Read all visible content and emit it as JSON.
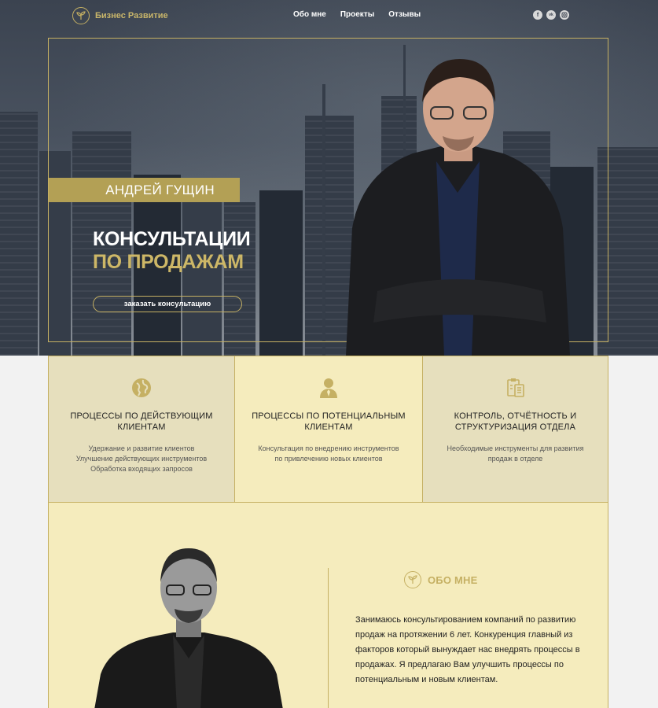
{
  "nav": {
    "logo_text": "Бизнес Развитие",
    "links": [
      "Обо мне",
      "Проекты",
      "Отзывы"
    ],
    "socials": [
      "f",
      "vk",
      "ig"
    ]
  },
  "hero": {
    "name": "АНДРЕЙ ГУЩИН",
    "headline_1": "КОНСУЛЬТАЦИИ",
    "headline_2": "ПО ПРОДАЖАМ",
    "cta": "заказать консультацию"
  },
  "services": [
    {
      "icon": "globe-icon",
      "title": "ПРОЦЕССЫ ПО ДЕЙСТВУЮЩИМ КЛИЕНТАМ",
      "desc": [
        "Удержание и развитие клиентов",
        "Улучшение действующих инструментов",
        "Обработка входящих запросов"
      ]
    },
    {
      "icon": "person-icon",
      "title": "ПРОЦЕССЫ ПО ПОТЕНЦИАЛЬНЫМ КЛИЕНТАМ",
      "desc": [
        "Консультация по внедрению инструментов",
        "по привлечению новых клиентов"
      ]
    },
    {
      "icon": "clipboard-icon",
      "title": "КОНТРОЛЬ, ОТЧЁТНОСТЬ И СТРУКТУРИЗАЦИЯ ОТДЕЛА",
      "desc": [
        "Необходимые инструменты для развития",
        "продаж в отделе"
      ]
    }
  ],
  "about": {
    "title": "ОБО МНЕ",
    "text": "Занимаюсь консультированием компаний по развитию продаж на протяжении 6 лет. Конкуренция главный из факторов который вынуждает нас внедрять процессы в продажах. Я предлагаю Вам улучшить процессы по потенциальным и новым клиентам."
  },
  "colors": {
    "gold": "#c5b063",
    "gold_bar": "#b3a055",
    "cream": "#f5ecbd",
    "beige": "#e6dfbd",
    "hero_dark": "#3b4350"
  }
}
